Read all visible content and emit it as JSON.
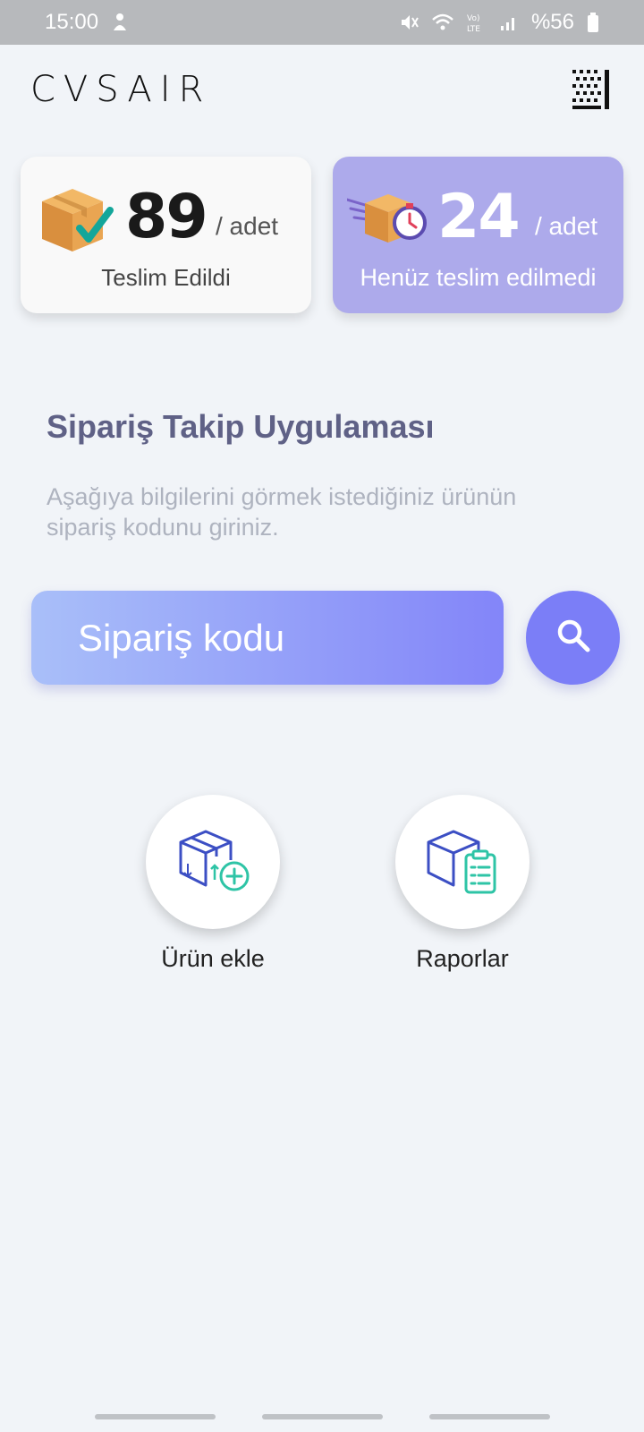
{
  "status_bar": {
    "time": "15:00",
    "battery": "%56",
    "icons": [
      "notification-icon",
      "mute-icon",
      "wifi-icon",
      "volte-lte-icon",
      "signal-icon",
      "battery-icon"
    ]
  },
  "header": {
    "brand": "CVSAIR",
    "qr_icon": "qr-code-icon"
  },
  "stats": {
    "delivered": {
      "count": "89",
      "unit": "/ adet",
      "label": "Teslim Edildi",
      "icon": "box-check-icon"
    },
    "pending": {
      "count": "24",
      "unit": "/ adet",
      "label": "Henüz teslim edilmedi",
      "icon": "box-timer-icon"
    }
  },
  "main": {
    "title": "Sipariş Takip Uygulaması",
    "description": "Aşağıya bilgilerini görmek istediğiniz ürünün sipariş kodunu giriniz."
  },
  "search": {
    "placeholder": "Sipariş kodu",
    "value": "",
    "icon": "search-icon"
  },
  "actions": {
    "add_product": {
      "label": "Ürün ekle",
      "icon": "box-add-icon"
    },
    "reports": {
      "label": "Raporlar",
      "icon": "box-report-icon"
    }
  },
  "colors": {
    "background": "#f1f4f8",
    "accent": "#7b7ef7",
    "pending_card": "#adaaeb",
    "title": "#5f6186"
  }
}
